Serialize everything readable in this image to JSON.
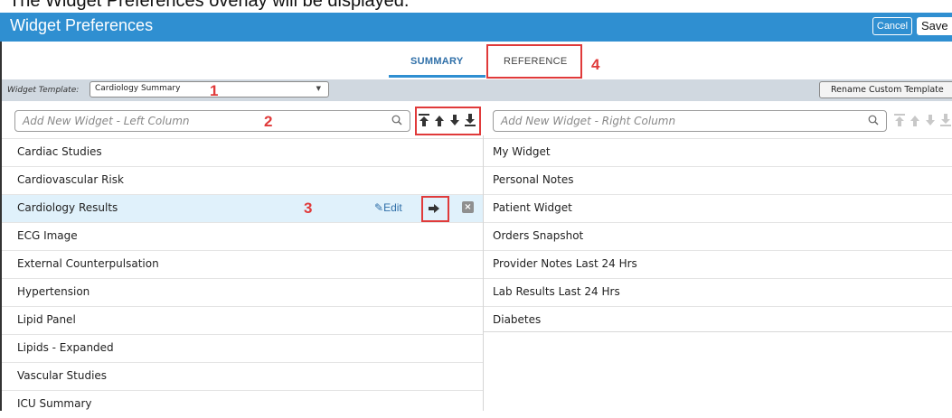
{
  "caption": "The Widget Preferences overlay will be displayed.",
  "window": {
    "title": "Widget Preferences",
    "cancel_label": "Cancel",
    "save_label": "Save"
  },
  "tabs": [
    {
      "label": "SUMMARY",
      "active": true
    },
    {
      "label": "REFERENCE",
      "active": false
    }
  ],
  "template": {
    "label": "Widget Template:",
    "value": "Cardiology Summary",
    "rename_label": "Rename Custom Template"
  },
  "left_column": {
    "placeholder": "Add New Widget - Left Column",
    "items": [
      "Cardiac Studies",
      "Cardiovascular Risk",
      "Cardiology Results",
      "ECG Image",
      "External Counterpulsation",
      "Hypertension",
      "Lipid Panel",
      "Lipids - Expanded",
      "Vascular Studies",
      "ICU Summary"
    ],
    "selected_index": 2,
    "edit_label": "Edit"
  },
  "right_column": {
    "placeholder": "Add New Widget - Right Column",
    "items": [
      "My Widget",
      "Personal Notes",
      "Patient Widget",
      "Orders Snapshot",
      "Provider Notes Last 24 Hrs",
      "Lab Results Last 24 Hrs",
      "Diabetes"
    ]
  },
  "annotations": [
    "1",
    "2",
    "3",
    "4"
  ],
  "colors": {
    "header": "#2f8fd1",
    "annotation": "#e03a3a",
    "selected_row": "#e0f1fb",
    "link": "#2f6fa8"
  },
  "icons": {
    "search": "magnifier-icon",
    "move_top": "arrow-to-top-icon",
    "move_up": "arrow-up-icon",
    "move_down": "arrow-down-icon",
    "move_bottom": "arrow-to-bottom-icon",
    "edit": "pencil-icon",
    "move_right": "arrow-right-icon",
    "remove": "close-box-icon",
    "dropdown": "caret-down-icon"
  }
}
